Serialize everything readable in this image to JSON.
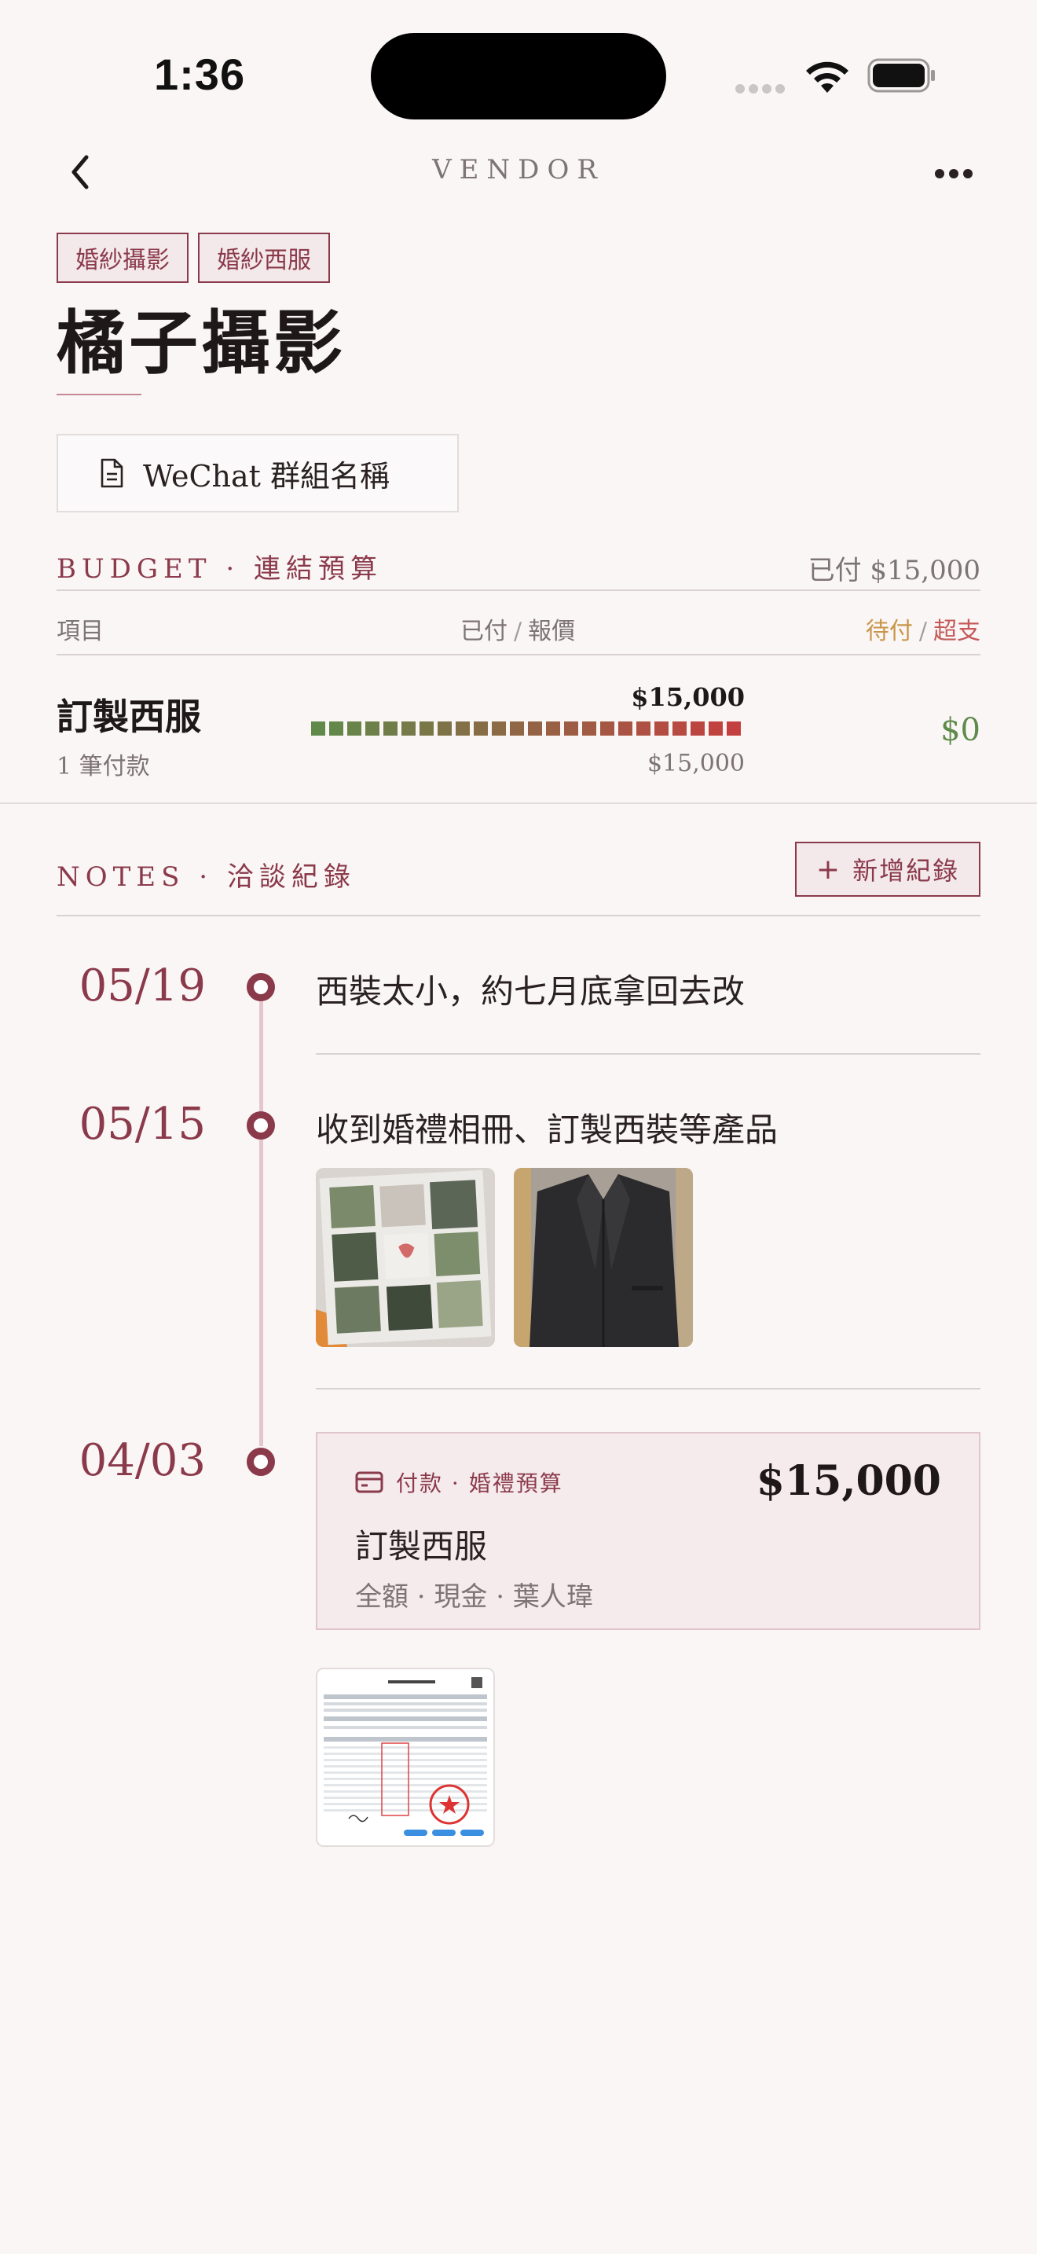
{
  "status_bar": {
    "time": "1:36"
  },
  "nav": {
    "title": "VENDOR"
  },
  "vendor": {
    "tags": [
      "婚紗攝影",
      "婚紗西服"
    ],
    "name": "橘子攝影",
    "wechat_label": "WeChat 群組名稱"
  },
  "budget": {
    "title": "BUDGET · 連結預算",
    "paid_summary": "已付 $15,000",
    "col_item": "項目",
    "col_paid": "已付",
    "col_quote": "報價",
    "col_due": "待付",
    "col_over": "超支",
    "slash": "/",
    "items": [
      {
        "name": "訂製西服",
        "count": "1 筆付款",
        "paid": "$15,000",
        "quote": "$15,000",
        "remaining": "$0",
        "progress_fraction": 1.0
      }
    ]
  },
  "notes": {
    "title": "NOTES · 洽談紀錄",
    "add_label": "新增紀錄",
    "entries": [
      {
        "date": "05/19",
        "text": "西裝太小，約七月底拿回去改"
      },
      {
        "date": "05/15",
        "text": "收到婚禮相冊、訂製西裝等產品"
      },
      {
        "date": "04/03",
        "payment": {
          "label": "付款 · 婚禮預算",
          "amount": "$15,000",
          "name": "訂製西服",
          "meta": "全額 · 現金 · 葉人瑋"
        }
      }
    ]
  },
  "colors": {
    "accent": "#8b3a4b",
    "positive": "#5e8a4a",
    "due": "#c9954a",
    "over": "#c45a5a",
    "background": "#faf6f5"
  },
  "icons": [
    "chevron-left-icon",
    "more-icon",
    "document-icon",
    "plus-icon",
    "card-icon",
    "wifi-icon",
    "battery-icon"
  ]
}
